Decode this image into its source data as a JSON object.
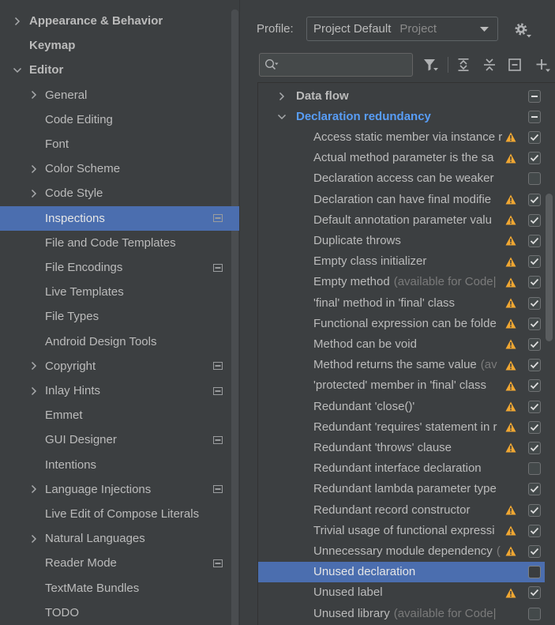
{
  "colors": {
    "background": "#3c3f41",
    "text": "#bbbbbb",
    "selection": "#4b6eaf",
    "modified_group": "#589df6",
    "warning": "#f0a732",
    "muted_text": "#7a7a7a"
  },
  "settings_tree": {
    "items": [
      {
        "label": "Appearance & Behavior",
        "depth": 0,
        "expandable": true,
        "expanded": false
      },
      {
        "label": "Keymap",
        "depth": 0
      },
      {
        "label": "Editor",
        "depth": 0,
        "expandable": true,
        "expanded": true
      },
      {
        "label": "General",
        "depth": 1,
        "expandable": true,
        "expanded": false
      },
      {
        "label": "Code Editing",
        "depth": 1
      },
      {
        "label": "Font",
        "depth": 1
      },
      {
        "label": "Color Scheme",
        "depth": 1,
        "expandable": true,
        "expanded": false
      },
      {
        "label": "Code Style",
        "depth": 1,
        "expandable": true,
        "expanded": false
      },
      {
        "label": "Inspections",
        "depth": 1,
        "selected": true,
        "icon": "project-settings-icon"
      },
      {
        "label": "File and Code Templates",
        "depth": 1
      },
      {
        "label": "File Encodings",
        "depth": 1,
        "icon": "project-settings-icon"
      },
      {
        "label": "Live Templates",
        "depth": 1
      },
      {
        "label": "File Types",
        "depth": 1
      },
      {
        "label": "Android Design Tools",
        "depth": 1
      },
      {
        "label": "Copyright",
        "depth": 1,
        "expandable": true,
        "expanded": false,
        "icon": "project-settings-icon"
      },
      {
        "label": "Inlay Hints",
        "depth": 1,
        "expandable": true,
        "expanded": false,
        "icon": "project-settings-icon"
      },
      {
        "label": "Emmet",
        "depth": 1
      },
      {
        "label": "GUI Designer",
        "depth": 1,
        "icon": "project-settings-icon"
      },
      {
        "label": "Intentions",
        "depth": 1
      },
      {
        "label": "Language Injections",
        "depth": 1,
        "expandable": true,
        "expanded": false,
        "icon": "project-settings-icon"
      },
      {
        "label": "Live Edit of Compose Literals",
        "depth": 1
      },
      {
        "label": "Natural Languages",
        "depth": 1,
        "expandable": true,
        "expanded": false
      },
      {
        "label": "Reader Mode",
        "depth": 1,
        "icon": "project-settings-icon"
      },
      {
        "label": "TextMate Bundles",
        "depth": 1
      },
      {
        "label": "TODO",
        "depth": 1
      }
    ]
  },
  "profile": {
    "label": "Profile:",
    "value": "Project Default",
    "scope": "Project"
  },
  "toolbar": {
    "search": {
      "value": ""
    },
    "icons": [
      "search-icon",
      "filter-icon",
      "expand-all-icon",
      "collapse-all-icon",
      "minus-box-icon",
      "plus-icon",
      "gear-icon"
    ]
  },
  "inspection_tree": {
    "rows": [
      {
        "group": true,
        "label": "Data flow",
        "expanded": false,
        "partially_checked": true
      },
      {
        "group": true,
        "label": "Declaration redundancy",
        "expanded": true,
        "partially_checked": true,
        "modified": true
      },
      {
        "label": "Access static member via instance r",
        "warning": true,
        "checked": true
      },
      {
        "label": "Actual method parameter is the sa",
        "warning": true,
        "checked": true
      },
      {
        "label": "Declaration access can be weaker",
        "warning": false,
        "checked": false
      },
      {
        "label": "Declaration can have final modifie",
        "warning": true,
        "checked": true
      },
      {
        "label": "Default annotation parameter valu",
        "warning": true,
        "checked": true
      },
      {
        "label": "Duplicate throws",
        "warning": true,
        "checked": true
      },
      {
        "label": "Empty class initializer",
        "warning": true,
        "checked": true
      },
      {
        "label": "Empty method",
        "note": "(available for Code|",
        "warning": true,
        "checked": true
      },
      {
        "label": "'final' method in 'final' class",
        "warning": true,
        "checked": true
      },
      {
        "label": "Functional expression can be folde",
        "warning": true,
        "checked": true
      },
      {
        "label": "Method can be void",
        "warning": true,
        "checked": true
      },
      {
        "label": "Method returns the same value",
        "note": "(av",
        "warning": true,
        "checked": true
      },
      {
        "label": "'protected' member in 'final' class",
        "warning": true,
        "checked": true
      },
      {
        "label": "Redundant 'close()'",
        "warning": true,
        "checked": true
      },
      {
        "label": "Redundant 'requires' statement in r",
        "warning": true,
        "checked": true
      },
      {
        "label": "Redundant 'throws' clause",
        "warning": true,
        "checked": true
      },
      {
        "label": "Redundant interface declaration",
        "warning": false,
        "checked": false
      },
      {
        "label": "Redundant lambda parameter type",
        "warning": false,
        "checked": true
      },
      {
        "label": "Redundant record constructor",
        "warning": true,
        "checked": true
      },
      {
        "label": "Trivial usage of functional expressi",
        "warning": true,
        "checked": true
      },
      {
        "label": "Unnecessary module dependency",
        "note": "(",
        "warning": true,
        "checked": true
      },
      {
        "label": "Unused declaration",
        "warning": false,
        "checked": false,
        "selected": true
      },
      {
        "label": "Unused label",
        "warning": true,
        "checked": true
      },
      {
        "label": "Unused library",
        "note": "(available for Code|",
        "warning": false,
        "checked": false
      }
    ]
  }
}
